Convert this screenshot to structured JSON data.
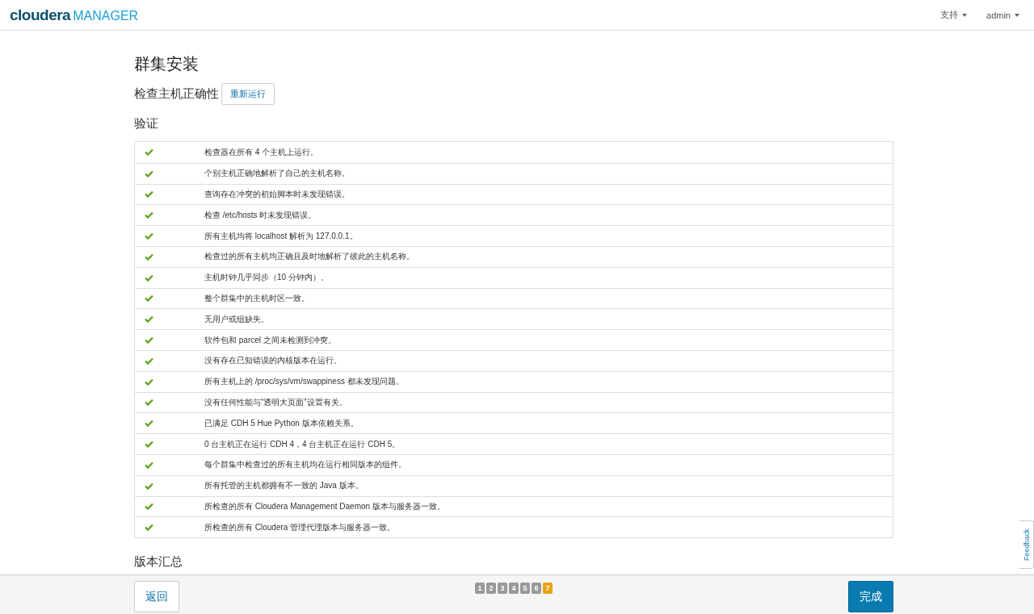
{
  "header": {
    "logo": {
      "brand": "cloudera",
      "product": "MANAGER"
    },
    "menus": [
      {
        "label": "支持"
      },
      {
        "label": "admin"
      }
    ]
  },
  "page": {
    "title": "群集安装",
    "subtitle": "检查主机正确性",
    "rerun_button": "重新运行",
    "section": "验证",
    "checks": [
      {
        "text": "检查器在所有 4 个主机上运行。",
        "passed": true
      },
      {
        "text": "个别主机正确地解析了自己的主机名称。",
        "passed": true
      },
      {
        "text": "查询存在冲突的初始脚本时未发现错误。",
        "passed": true
      },
      {
        "text": "检查 /etc/hosts 时未发现错误。",
        "passed": true
      },
      {
        "text": "所有主机均将 localhost 解析为 127.0.0.1。",
        "passed": true
      },
      {
        "text": "检查过的所有主机均正确且及时地解析了彼此的主机名称。",
        "passed": true
      },
      {
        "text": "主机时钟几乎同步（10 分钟内）。",
        "passed": true
      },
      {
        "text": "整个群集中的主机时区一致。",
        "passed": true
      },
      {
        "text": "无用户或组缺失。",
        "passed": true
      },
      {
        "text": "软件包和 parcel 之间未检测到冲突。",
        "passed": true
      },
      {
        "text": "没有存在已知错误的内核版本在运行。",
        "passed": true
      },
      {
        "text": "所有主机上的 /proc/sys/vm/swappiness 都未发现问题。",
        "passed": true
      },
      {
        "text": "没有任何性能与“透明大页面”设置有关。",
        "passed": true
      },
      {
        "text": "已满足 CDH 5 Hue Python 版本依赖关系。",
        "passed": true
      },
      {
        "text": "0 台主机正在运行 CDH 4，4 台主机正在运行 CDH 5。",
        "passed": true
      },
      {
        "text": "每个群集中检查过的所有主机均在运行相同版本的组件。",
        "passed": true
      },
      {
        "text": "所有托管的主机都拥有不一致的 Java 版本。",
        "passed": true
      },
      {
        "text": "所检查的所有 Cloudera Management Daemon 版本与服务器一致。",
        "passed": true
      },
      {
        "text": "所检查的所有 Cloudera 管理代理版本与服务器一致。",
        "passed": true
      }
    ],
    "next_section": "版本汇总"
  },
  "footer": {
    "back_button": "返回",
    "steps": [
      {
        "label": "1",
        "selected": false
      },
      {
        "label": "2",
        "selected": false
      },
      {
        "label": "3",
        "selected": false
      },
      {
        "label": "4",
        "selected": false
      },
      {
        "label": "5",
        "selected": false
      },
      {
        "label": "6",
        "selected": false
      },
      {
        "label": "7",
        "selected": true
      }
    ],
    "finish_button": "完成"
  },
  "feedback_tab": "Feedback"
}
